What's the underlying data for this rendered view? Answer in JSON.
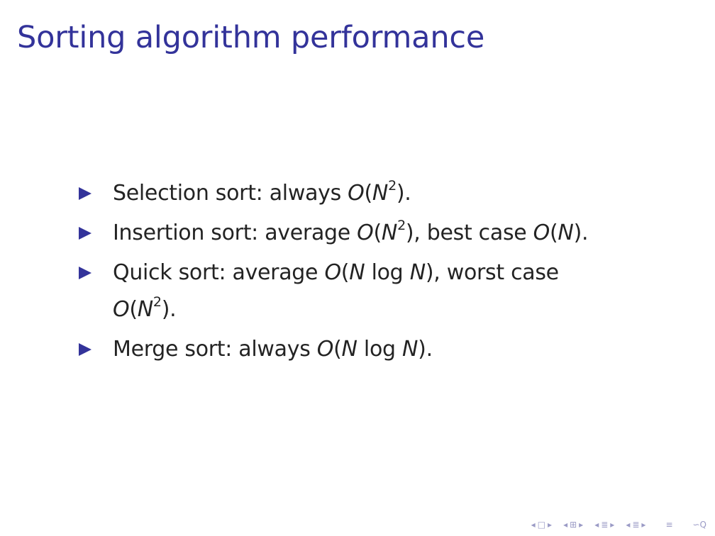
{
  "slide": {
    "title": "Sorting algorithm performance",
    "accent_color": "#33339a",
    "bullet_color": "#33339a",
    "bullet_icon": "right-triangle-icon",
    "bullets": [
      {
        "prefix": "Selection sort: always ",
        "complexity": {
          "O": "O",
          "N": "N",
          "exp": "2"
        },
        "suffix": "."
      },
      {
        "prefix": "Insertion sort: average ",
        "complexity_avg": {
          "O": "O",
          "N": "N",
          "exp": "2"
        },
        "middle": ", best case ",
        "complexity_best": {
          "O": "O",
          "N": "N"
        },
        "suffix": "."
      },
      {
        "prefix": "Quick sort: average ",
        "complexity_avg": {
          "O": "O",
          "N1": "N",
          "log": "log",
          "N2": "N"
        },
        "middle": ", worst case",
        "complexity_worst": {
          "O": "O",
          "N": "N",
          "exp": "2"
        },
        "suffix": "."
      },
      {
        "prefix": "Merge sort: always ",
        "complexity": {
          "O": "O",
          "N1": "N",
          "log": "log",
          "N2": "N"
        },
        "suffix": "."
      }
    ]
  },
  "navigation": {
    "icons": [
      "nav-prev-arrow-icon",
      "nav-frame-icon",
      "nav-next-arrow-icon",
      "nav-prev-arrow-icon",
      "nav-subsection-icon",
      "nav-next-arrow-icon",
      "nav-prev-arrow-icon",
      "nav-section-icon",
      "nav-next-arrow-icon",
      "nav-prev-arrow-icon",
      "nav-section-list-icon",
      "nav-next-arrow-icon",
      "nav-align-icon",
      "nav-search-icon"
    ],
    "glyphs": {
      "left": "◂",
      "right": "▸",
      "frame": "□",
      "subsection": "⊞",
      "section": "≣",
      "align": "≡",
      "search": "∽Q"
    }
  }
}
